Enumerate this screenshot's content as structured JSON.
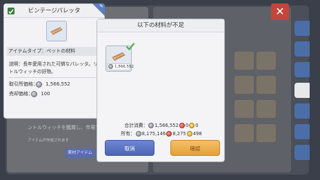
{
  "background": {
    "hint_line1": "ントルウィッチを鑑賞し、市場で購入",
    "hint_line2": "アイテムが作成されます",
    "button_label": "素材アイテム"
  },
  "item_detail": {
    "title": "ビンテージパレッタ",
    "type_label": "アイテムタイプ：ペットの材料",
    "description": "説明：長年愛用された可憐なパレッタ。リトルウィッチの好物。",
    "trade_price_label": "取引所価格：",
    "trade_price_value": "1,566,552",
    "sell_price_label": "売却価格：",
    "sell_price_value": "100"
  },
  "dialog": {
    "title": "以下の材料が不足",
    "material": {
      "price": "1,566,552",
      "icon": "barrette-icon"
    },
    "total_label": "合計消費：",
    "total_zeny": "1,566,552",
    "total_red": "0",
    "total_gold": "0",
    "owned_label": "所有：",
    "owned_zeny": "8,175,146",
    "owned_red": "8,275",
    "owned_gold": "498",
    "cancel_label": "取消",
    "confirm_label": "確認"
  },
  "colors": {
    "cancel_button": "#5a73c4",
    "confirm_button": "#eeaa45",
    "check": "#4cae4c"
  }
}
